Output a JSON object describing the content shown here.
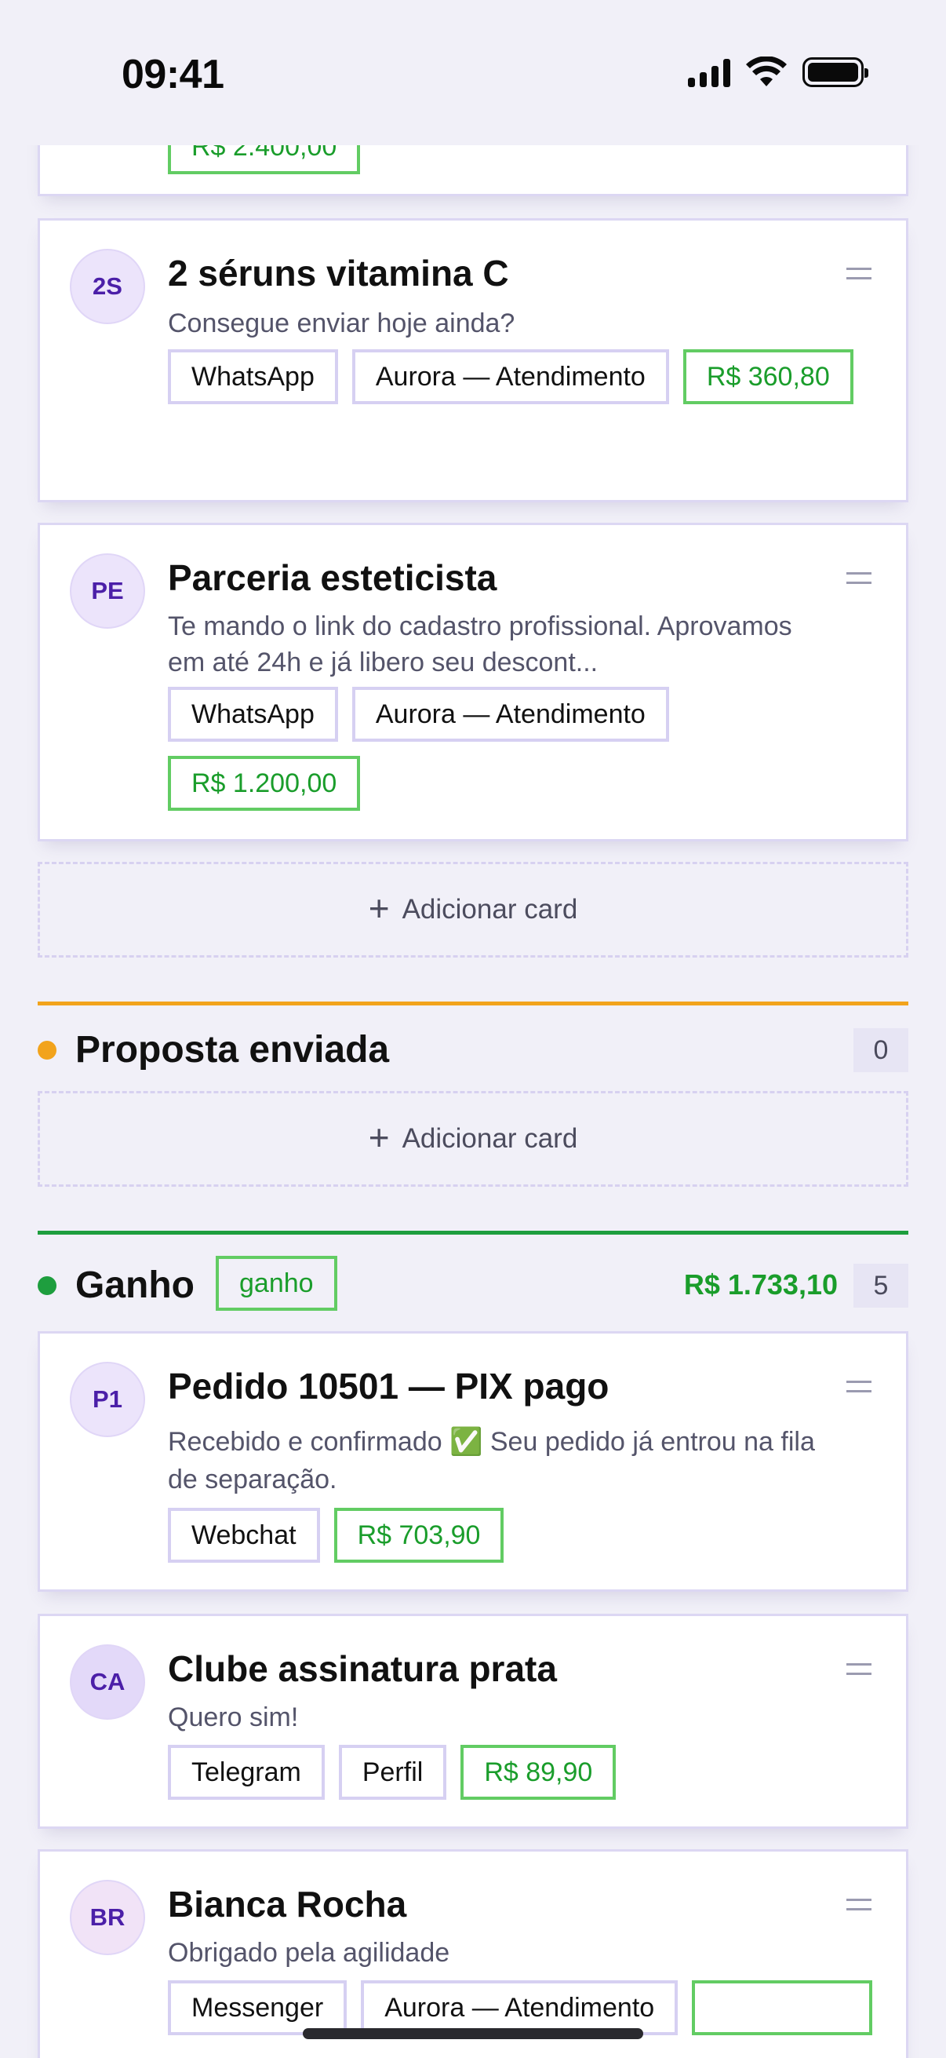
{
  "status": {
    "time": "09:41"
  },
  "cards_top": [
    {
      "avatar": "2S",
      "title": "2 séruns vitamina C",
      "subtitle": "Consegue enviar hoje ainda?",
      "channel": "WhatsApp",
      "agent": "Aurora — Atendimento",
      "value": "R$ 360,80"
    },
    {
      "avatar": "PE",
      "title": "Parceria esteticista",
      "subtitle": "Te mando o link do cadastro profissional. Aprovamos em até 24h e já libero seu descont...",
      "channel": "WhatsApp",
      "agent": "Aurora — Atendimento",
      "value": "R$ 1.200,00"
    }
  ],
  "partial_top_value": "R$ 2.400,00",
  "add_card_label": "Adicionar card",
  "columns": {
    "proposta": {
      "title": "Proposta enviada",
      "count": "0",
      "color": "#f2a31c"
    },
    "ganho": {
      "title": "Ganho",
      "tag": "ganho",
      "total": "R$ 1.733,10",
      "count": "5",
      "color": "#1e9e3e"
    }
  },
  "cards_ganho": [
    {
      "avatar": "P1",
      "title": "Pedido 10501 — PIX pago",
      "subtitle": "Recebido e confirmado ✅ Seu pedido já entrou na fila de separação.",
      "chips": [
        "Webchat"
      ],
      "value": "R$ 703,90"
    },
    {
      "avatar": "CA",
      "title": "Clube assinatura prata",
      "subtitle": "Quero sim!",
      "chips": [
        "Telegram",
        "Perfil"
      ],
      "value": "R$ 89,90"
    },
    {
      "avatar": "BR",
      "title": "Bianca Rocha",
      "subtitle": "Obrigado pela agilidade",
      "chips": [
        "Messenger",
        "Aurora — Atendimento"
      ],
      "value": ""
    }
  ]
}
